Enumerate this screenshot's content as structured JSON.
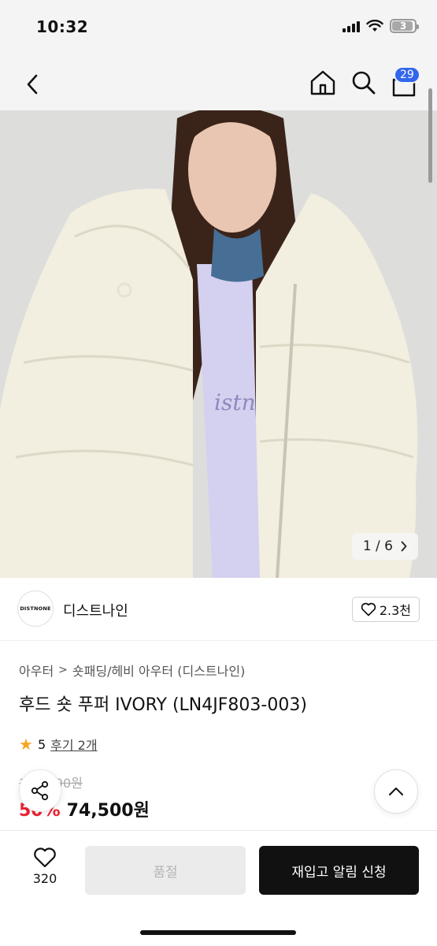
{
  "status": {
    "time": "10:32",
    "battery": "3"
  },
  "nav": {
    "cart_count": "29"
  },
  "gallery": {
    "counter": "1 / 6"
  },
  "brand": {
    "logo_text": "DISTNONE",
    "name": "디스트나인",
    "likes": "2.3천"
  },
  "product": {
    "category": [
      "아우터",
      "숏패딩/헤비 아우터 (디스트나인)"
    ],
    "title": "후드 숏 푸퍼 IVORY (LN4JF803-003)",
    "rating": "5",
    "reviews": "후기 2개",
    "original_price": "149,000원",
    "discount": "50%",
    "price": "74,500원"
  },
  "bottom": {
    "wish_count": "320",
    "soldout_label": "품절",
    "restock_label": "재입고 알림 신청"
  },
  "colors": {
    "accent": "#3366ee",
    "discount": "#ee2233",
    "star": "#f5a623"
  }
}
